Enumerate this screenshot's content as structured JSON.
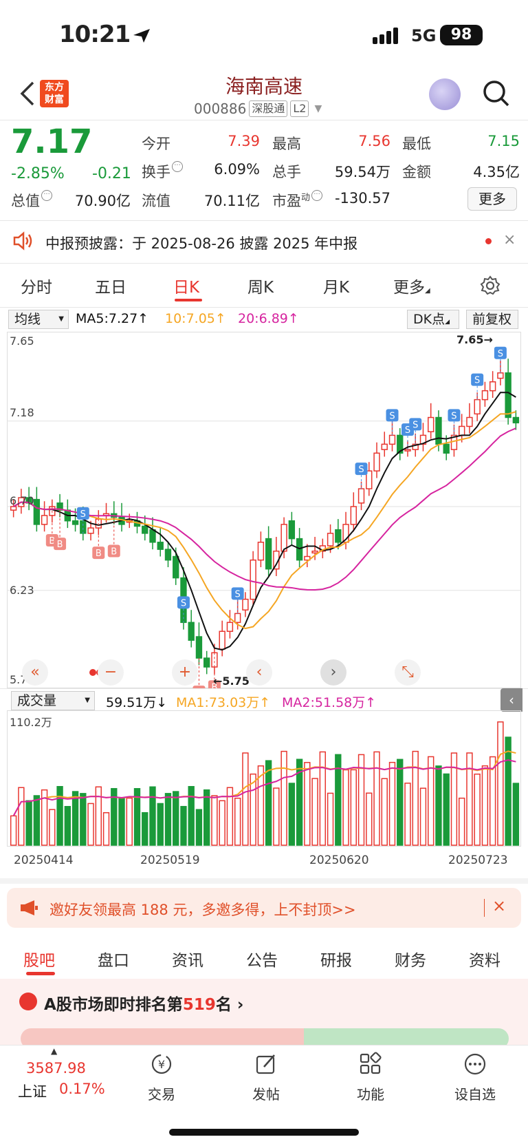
{
  "status": {
    "time": "10:21",
    "network": "5G",
    "battery": "98"
  },
  "header": {
    "title": "海南高速",
    "code": "000886",
    "tag1": "深股通",
    "tag2": "L2",
    "logo_line1": "东方",
    "logo_line2": "财富"
  },
  "quote": {
    "price": "7.17",
    "change_pct": "-2.85%",
    "change_val": "-0.21",
    "open_label": "今开",
    "open": "7.39",
    "high_label": "最高",
    "high": "7.56",
    "low_label": "最低",
    "low": "7.15",
    "turnover_label": "换手",
    "turnover": "6.09%",
    "volume_label": "总手",
    "volume": "59.54万",
    "amount_label": "金额",
    "amount": "4.35亿",
    "total_cap_label": "总值",
    "total_cap": "70.90亿",
    "float_cap_label": "流值",
    "float_cap": "70.11亿",
    "pe_label": "市盈",
    "pe_sup": "动",
    "pe": "-130.57",
    "more": "更多"
  },
  "notice": {
    "text": "中报预披露：于 2025-08-26 披露 2025 年中报",
    "close": "×"
  },
  "chart_tabs": [
    "分时",
    "五日",
    "日K",
    "周K",
    "月K",
    "更多"
  ],
  "indicators": {
    "ma_select": "均线",
    "ma5": "MA5:7.27↑",
    "ma10": "10:7.05↑",
    "ma20": "20:6.89↑",
    "dk": "DK点",
    "adjust": "前复权",
    "vol_select": "成交量",
    "vol": "59.51万↓",
    "vol_ma1": "MA1:73.03万↑",
    "vol_ma2": "MA2:51.58万↑"
  },
  "chart_labels": {
    "y_top": "7.65",
    "y_mid": "7.18",
    "y_low1": "6.70",
    "y_low2": "6.23",
    "y_bottom": "5.75",
    "max_mark": "7.65→",
    "min_mark": "←5.75",
    "vol_max": "110.2万",
    "dates": [
      "20250414",
      "20250519",
      "20250620",
      "20250723"
    ],
    "signal_s": "S",
    "signal_b": "B"
  },
  "chart_data": {
    "type": "candlestick",
    "ylim": [
      5.75,
      7.65
    ],
    "series": [
      {
        "name": "日K",
        "values": [
          6.7,
          6.75,
          6.72,
          6.6,
          6.65,
          6.7,
          6.68,
          6.62,
          6.6,
          6.55,
          6.58,
          6.63,
          6.66,
          6.64,
          6.6,
          6.62,
          6.59,
          6.55,
          6.5,
          6.46,
          6.4,
          6.3,
          6.05,
          5.95,
          5.85,
          5.8,
          5.88,
          6.0,
          6.05,
          6.1,
          6.18,
          6.4,
          6.5,
          6.35,
          6.45,
          6.6,
          6.52,
          6.4,
          6.42,
          6.45,
          6.48,
          6.55,
          6.5,
          6.6,
          6.7,
          6.8,
          6.9,
          7.0,
          7.05,
          7.1,
          7.0,
          7.02,
          7.05,
          7.1,
          7.2,
          7.05,
          7.0,
          7.1,
          7.15,
          7.2,
          7.3,
          7.35,
          7.4,
          7.45,
          7.2,
          7.17
        ]
      }
    ],
    "volume_ylim": [
      0,
      110.2
    ],
    "volume_unit": "万"
  },
  "promo": {
    "text": "邀好友领最高 188 元，多邀多得，上不封顶>>",
    "close": "×"
  },
  "bottom_tabs": [
    "股吧",
    "盘口",
    "资讯",
    "公告",
    "研报",
    "财务",
    "资料"
  ],
  "rank": {
    "text_prefix": "A股市场即时排名第",
    "rank": "519",
    "text_suffix": "名 ›"
  },
  "nav": {
    "index_value": "3587.98",
    "index_name": "上证",
    "index_pct": "0.17%",
    "items": [
      "交易",
      "发帖",
      "功能",
      "设自选"
    ]
  },
  "colors": {
    "up": "#e8362f",
    "down": "#1a9a3a",
    "ma5": "#111111",
    "ma10": "#f5a623",
    "ma20": "#d6249f"
  }
}
